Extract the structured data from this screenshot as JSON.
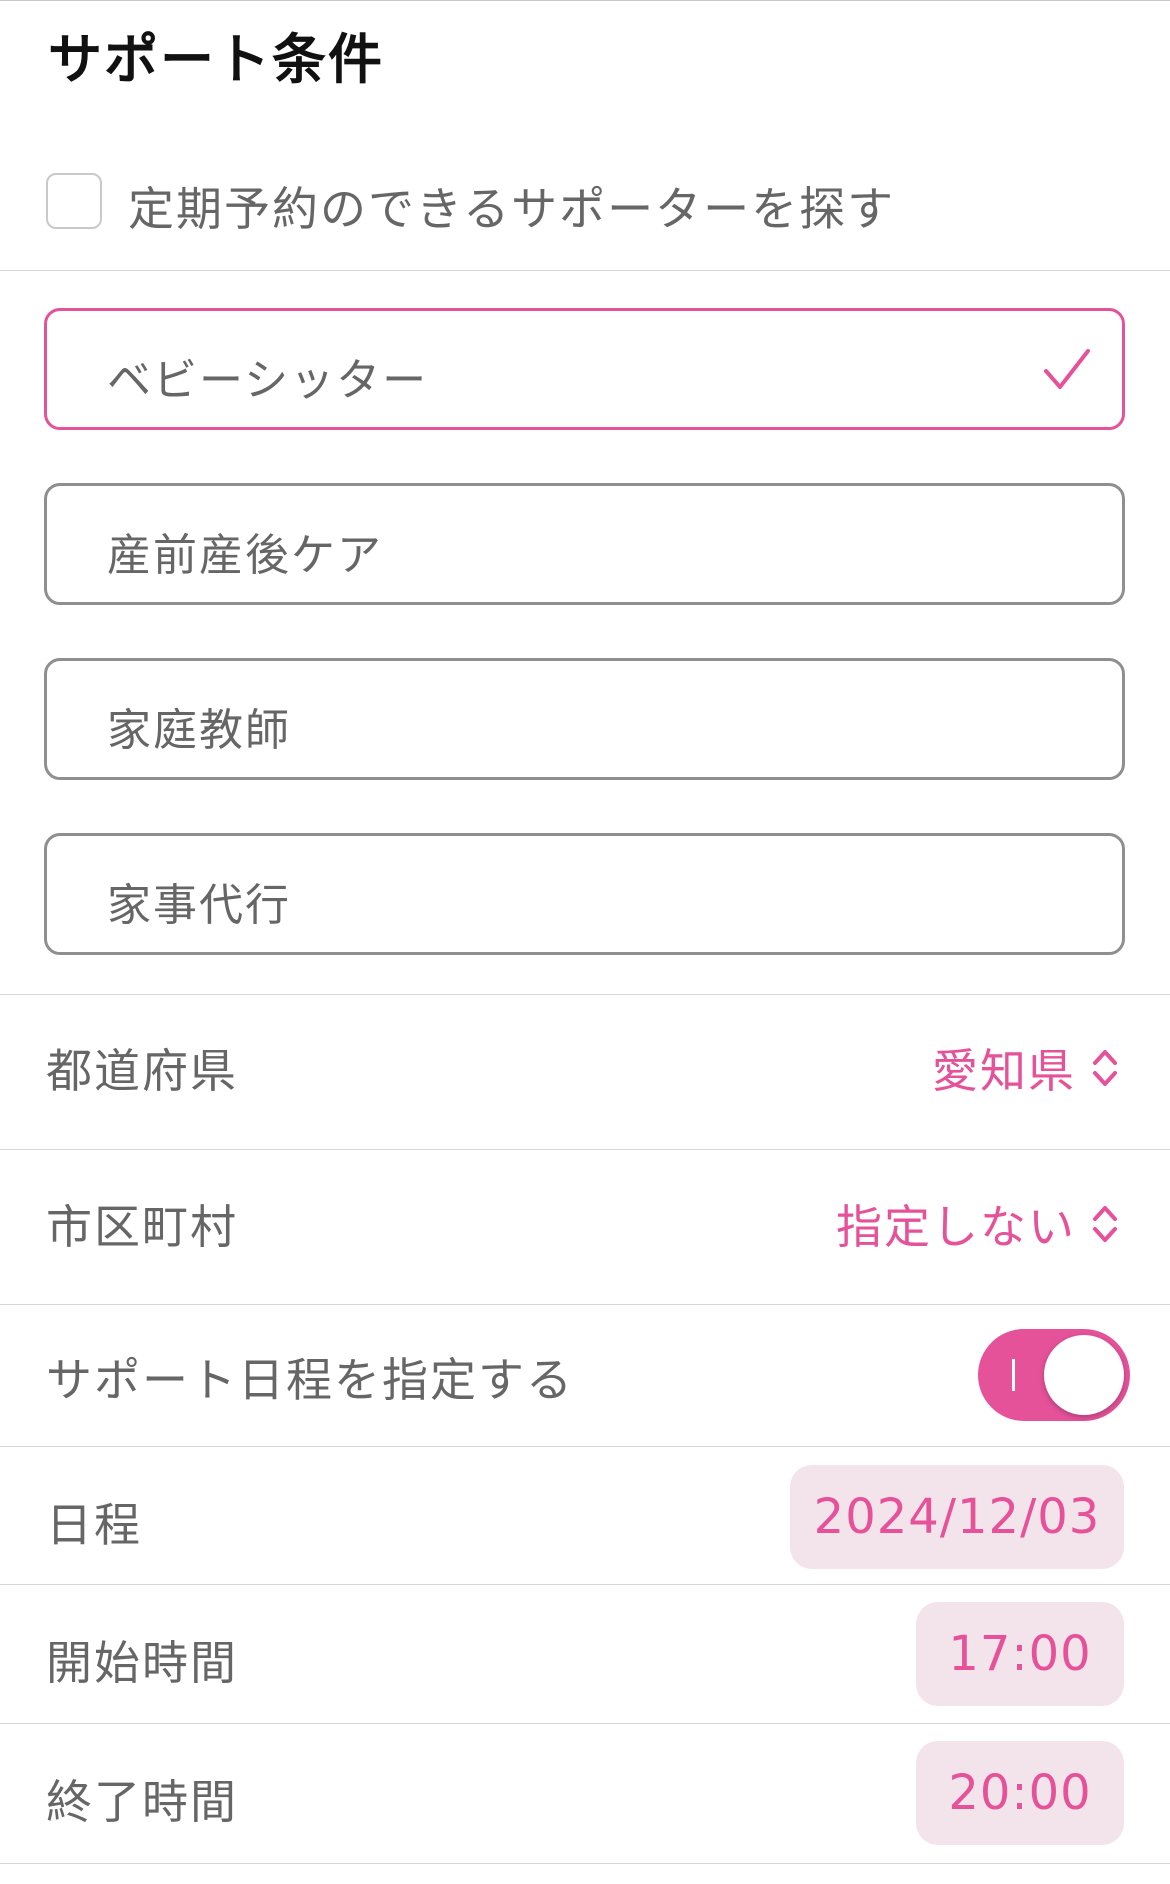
{
  "section_title": "サポート条件",
  "recurring_checkbox": {
    "label": "定期予約のできるサポーターを探す",
    "checked": false
  },
  "service_options": [
    {
      "label": "ベビーシッター",
      "selected": true
    },
    {
      "label": "産前産後ケア",
      "selected": false
    },
    {
      "label": "家庭教師",
      "selected": false
    },
    {
      "label": "家事代行",
      "selected": false
    }
  ],
  "prefecture": {
    "label": "都道府県",
    "value": "愛知県"
  },
  "city": {
    "label": "市区町村",
    "value": "指定しない"
  },
  "schedule_toggle": {
    "label": "サポート日程を指定する",
    "on": true
  },
  "date": {
    "label": "日程",
    "value": "2024/12/03"
  },
  "start_time": {
    "label": "開始時間",
    "value": "17:00"
  },
  "end_time": {
    "label": "終了時間",
    "value": "20:00"
  },
  "colors": {
    "accent": "#e5529a",
    "pill_background": "#f3e3ea",
    "text": "#666666",
    "title": "#111111"
  },
  "icons": {
    "selected_option": "checkmark-icon",
    "picker": "chevron-up-down-icon"
  }
}
